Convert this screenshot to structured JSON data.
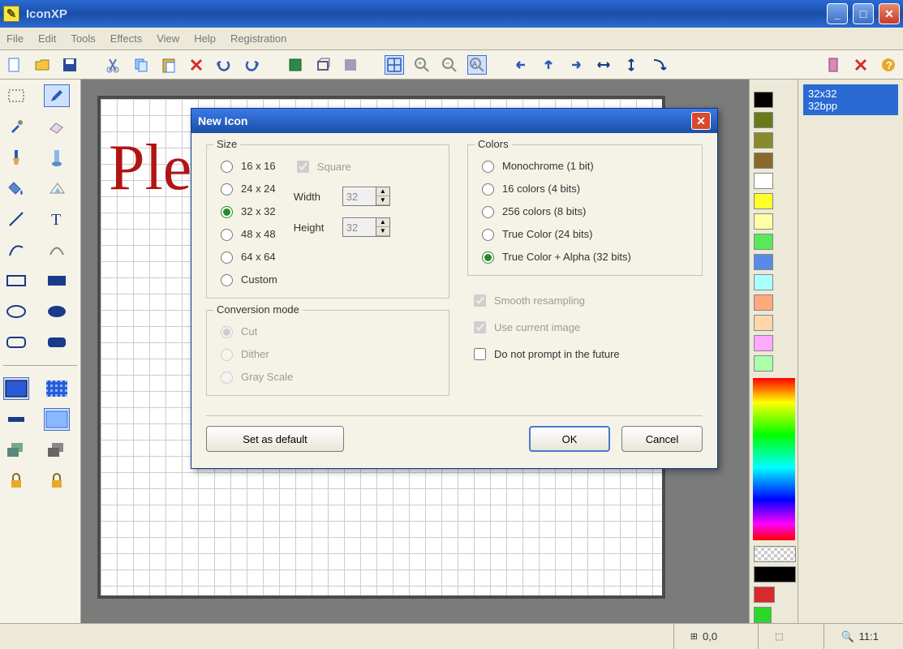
{
  "window": {
    "title": "IconXP"
  },
  "menu": [
    "File",
    "Edit",
    "Tools",
    "Effects",
    "View",
    "Help",
    "Registration"
  ],
  "canvas": {
    "text": "Ple"
  },
  "formats": {
    "size": "32x32",
    "bpp": "32bpp"
  },
  "status": {
    "coords": "0,0",
    "zoom": "11:1"
  },
  "dialog": {
    "title": "New Icon",
    "size": {
      "legend": "Size",
      "options": [
        "16 x 16",
        "24 x 24",
        "32 x 32",
        "48 x 48",
        "64 x 64",
        "Custom"
      ],
      "selected": "32 x 32",
      "square": "Square",
      "width_label": "Width",
      "height_label": "Height",
      "width": "32",
      "height": "32"
    },
    "colors": {
      "legend": "Colors",
      "options": [
        "Monochrome (1 bit)",
        "16 colors (4 bits)",
        "256 colors (8 bits)",
        "True Color (24 bits)",
        "True Color + Alpha (32 bits)"
      ],
      "selected": "True Color + Alpha (32 bits)"
    },
    "conv": {
      "legend": "Conversion mode",
      "options": [
        "Cut",
        "Dither",
        "Gray Scale"
      ],
      "selected": "Cut"
    },
    "checks": {
      "smooth": "Smooth resampling",
      "usecurrent": "Use current image",
      "noprompt": "Do not prompt in the future"
    },
    "buttons": {
      "setdefault": "Set as default",
      "ok": "OK",
      "cancel": "Cancel"
    }
  }
}
